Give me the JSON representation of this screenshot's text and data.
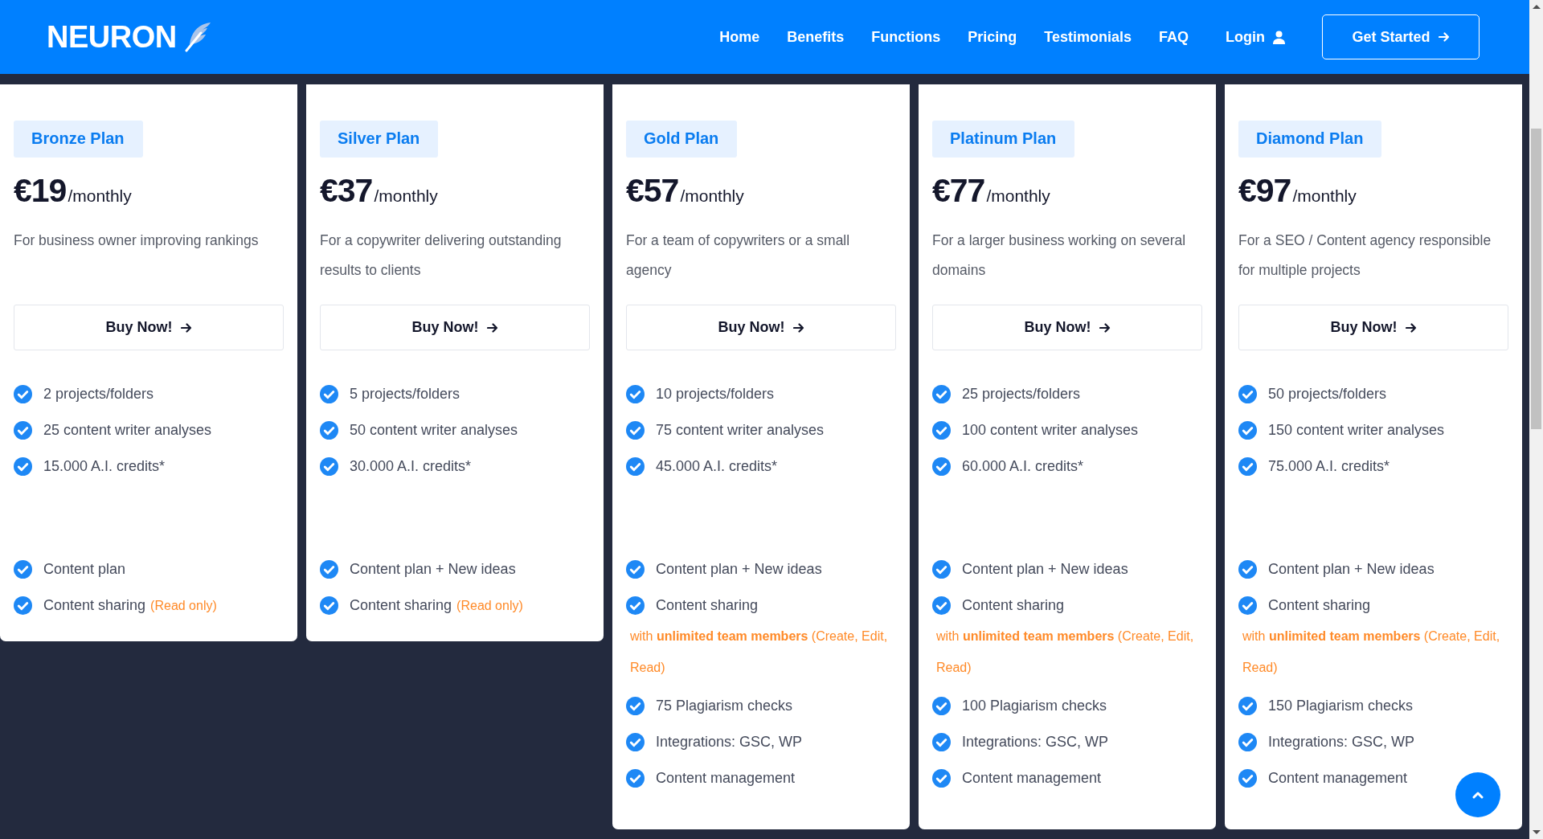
{
  "header": {
    "logo": "NEURON",
    "nav": [
      {
        "label": "Home"
      },
      {
        "label": "Benefits"
      },
      {
        "label": "Functions"
      },
      {
        "label": "Pricing"
      },
      {
        "label": "Testimonials"
      },
      {
        "label": "FAQ"
      }
    ],
    "login": "Login",
    "cta": "Get Started"
  },
  "plans": [
    {
      "name": "Bronze Plan",
      "price": "€19",
      "period": "/monthly",
      "description": "For business owner improving rankings",
      "button": "Buy Now!",
      "features": [
        {
          "kind": "check",
          "text": "2 projects/folders"
        },
        {
          "kind": "check",
          "text": "25 content writer analyses"
        },
        {
          "kind": "check",
          "text": "15.000 A.I. credits*"
        }
      ],
      "extras": [
        {
          "kind": "check",
          "text": "Content plan"
        },
        {
          "kind": "check",
          "text": "Content sharing",
          "note": "(Read only)"
        }
      ]
    },
    {
      "name": "Silver Plan",
      "price": "€37",
      "period": "/monthly",
      "description": "For a copywriter delivering outstanding results to clients",
      "button": "Buy Now!",
      "features": [
        {
          "kind": "check",
          "text": "5 projects/folders"
        },
        {
          "kind": "check",
          "text": "50 content writer analyses"
        },
        {
          "kind": "check",
          "text": "30.000 A.I. credits*"
        }
      ],
      "extras": [
        {
          "kind": "check",
          "text": "Content plan + New ideas"
        },
        {
          "kind": "check",
          "text": "Content sharing",
          "note": "(Read only)"
        }
      ]
    },
    {
      "name": "Gold Plan",
      "price": "€57",
      "period": "/monthly",
      "description": "For a team of copywriters or a small agency",
      "button": "Buy Now!",
      "features": [
        {
          "kind": "check",
          "text": "10 projects/folders"
        },
        {
          "kind": "check",
          "text": "75 content writer analyses"
        },
        {
          "kind": "check",
          "text": "45.000 A.I. credits*"
        }
      ],
      "extras": [
        {
          "kind": "check",
          "text": "Content plan + New ideas"
        },
        {
          "kind": "check",
          "text": "Content sharing"
        },
        {
          "kind": "note",
          "text": "with **unlimited team members** (Create, Edit, Read)"
        },
        {
          "kind": "check",
          "text": "75 Plagiarism checks"
        },
        {
          "kind": "check",
          "text": "Integrations: GSC, WP"
        },
        {
          "kind": "check",
          "text": "Content management"
        }
      ]
    },
    {
      "name": "Platinum Plan",
      "price": "€77",
      "period": "/monthly",
      "description": "For a larger business working on several domains",
      "button": "Buy Now!",
      "features": [
        {
          "kind": "check",
          "text": "25 projects/folders"
        },
        {
          "kind": "check",
          "text": "100 content writer analyses"
        },
        {
          "kind": "check",
          "text": "60.000 A.I. credits*"
        }
      ],
      "extras": [
        {
          "kind": "check",
          "text": "Content plan + New ideas"
        },
        {
          "kind": "check",
          "text": "Content sharing"
        },
        {
          "kind": "note",
          "text": "with **unlimited team members** (Create, Edit, Read)"
        },
        {
          "kind": "check",
          "text": "100 Plagiarism checks"
        },
        {
          "kind": "check",
          "text": "Integrations: GSC, WP"
        },
        {
          "kind": "check",
          "text": "Content management"
        }
      ]
    },
    {
      "name": "Diamond Plan",
      "price": "€97",
      "period": "/monthly",
      "description": "For a SEO / Content agency responsible for multiple projects",
      "button": "Buy Now!",
      "features": [
        {
          "kind": "check",
          "text": "50 projects/folders"
        },
        {
          "kind": "check",
          "text": "150 content writer analyses"
        },
        {
          "kind": "check",
          "text": "75.000 A.I. credits*"
        }
      ],
      "extras": [
        {
          "kind": "check",
          "text": "Content plan + New ideas"
        },
        {
          "kind": "check",
          "text": "Content sharing"
        },
        {
          "kind": "note",
          "text": "with **unlimited team members** (Create, Edit, Read)"
        },
        {
          "kind": "check",
          "text": "150 Plagiarism checks"
        },
        {
          "kind": "check",
          "text": "Integrations: GSC, WP"
        },
        {
          "kind": "check",
          "text": "Content management"
        }
      ]
    }
  ]
}
